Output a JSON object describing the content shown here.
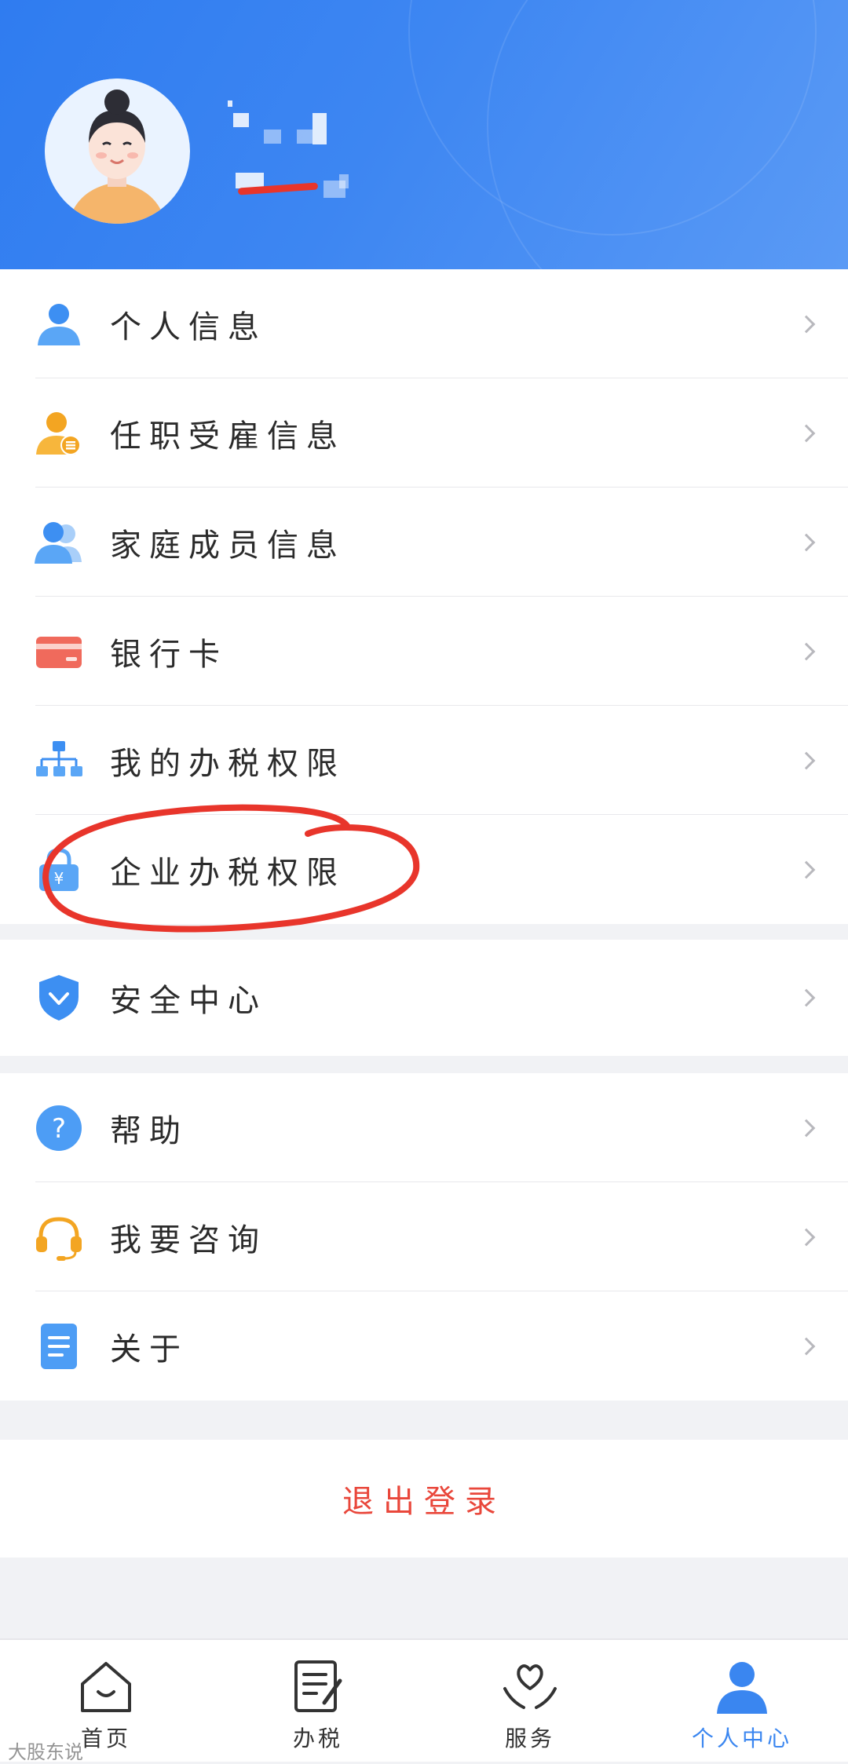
{
  "menu_group_1": [
    {
      "label": "个人信息",
      "icon": "person-icon"
    },
    {
      "label": "任职受雇信息",
      "icon": "employee-badge-icon"
    },
    {
      "label": "家庭成员信息",
      "icon": "family-icon"
    },
    {
      "label": "银行卡",
      "icon": "bank-card-icon"
    },
    {
      "label": "我的办税权限",
      "icon": "org-tree-icon"
    },
    {
      "label": "企业办税权限",
      "icon": "enterprise-lock-icon"
    }
  ],
  "menu_group_2": [
    {
      "label": "安全中心",
      "icon": "shield-icon"
    }
  ],
  "menu_group_3": [
    {
      "label": "帮助",
      "icon": "question-icon"
    },
    {
      "label": "我要咨询",
      "icon": "headset-icon"
    },
    {
      "label": "关于",
      "icon": "document-icon"
    }
  ],
  "logout": {
    "label": "退出登录"
  },
  "tabs": [
    {
      "label": "首页",
      "icon": "home-icon"
    },
    {
      "label": "办税",
      "icon": "tax-form-icon"
    },
    {
      "label": "服务",
      "icon": "heart-hands-icon"
    },
    {
      "label": "个人中心",
      "icon": "user-center-icon"
    }
  ],
  "colors": {
    "header_blue": "#3d86f2",
    "accent_blue": "#3a86f0",
    "logout_red": "#e9473b",
    "annotation_red": "#e8352b"
  },
  "watermark": "大股东说"
}
